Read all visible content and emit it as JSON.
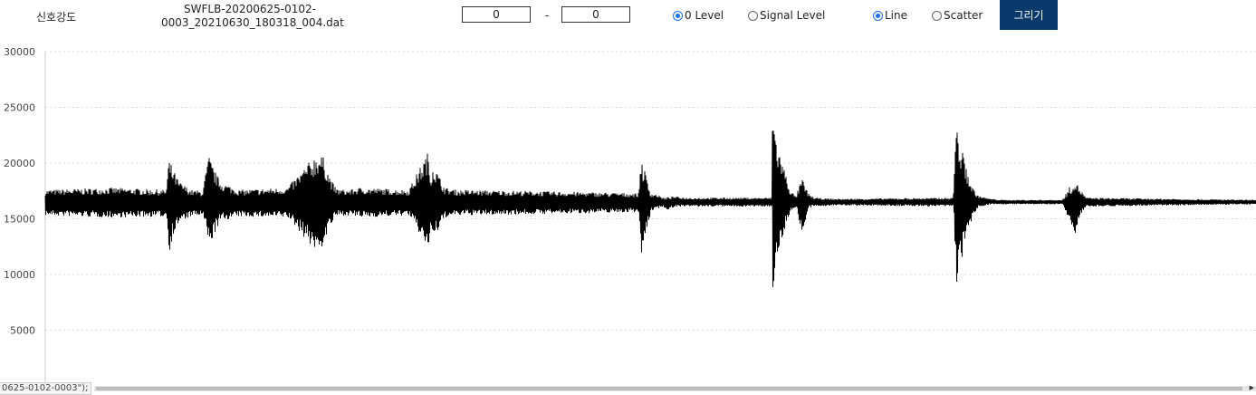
{
  "toolbar": {
    "signal_strength_label": "신호강도",
    "filename_line1": "SWFLB-20200625-0102-",
    "filename_line2": "0003_20210630_180318_004.dat",
    "range_start": "0",
    "range_separator": "-",
    "range_end": "0",
    "radio_zero_level": "0 Level",
    "radio_signal_level": "Signal Level",
    "radio_line": "Line",
    "radio_scatter": "Scatter",
    "level_selected": "0 Level",
    "mode_selected": "Line",
    "draw_button": "그리기"
  },
  "scroll_tooltip": "0625-0102-0003\");",
  "chart_data": {
    "type": "line",
    "title": "",
    "xlabel": "",
    "ylabel": "",
    "ylim": [
      0,
      30000
    ],
    "yticks": [
      5000,
      10000,
      15000,
      20000,
      25000,
      30000
    ],
    "grid": true,
    "line_color": "#000000",
    "baseline": 16500,
    "series": [
      {
        "x_fraction": [
          0.0,
          0.055,
          0.1,
          0.102,
          0.105,
          0.11,
          0.12,
          0.13,
          0.135,
          0.14,
          0.145,
          0.16,
          0.2,
          0.225,
          0.23,
          0.235,
          0.24,
          0.25,
          0.26,
          0.3,
          0.316,
          0.318,
          0.32,
          0.33,
          0.34,
          0.4,
          0.49,
          0.492,
          0.5,
          0.505,
          0.51,
          0.513,
          0.516,
          0.52,
          0.53,
          0.6,
          0.6,
          0.605,
          0.61,
          0.615,
          0.62,
          0.625,
          0.63,
          0.635,
          0.65,
          0.66,
          0.75,
          0.752,
          0.758,
          0.765,
          0.77,
          0.78,
          0.79,
          0.84,
          0.85,
          0.855,
          0.86,
          1.0
        ],
        "envelope_high": [
          17600,
          17800,
          17600,
          20400,
          19600,
          18400,
          17600,
          17500,
          20700,
          19300,
          18300,
          17600,
          17800,
          21000,
          20500,
          18800,
          17700,
          17600,
          17800,
          17600,
          21000,
          18800,
          20000,
          17800,
          17600,
          17500,
          17300,
          20700,
          17300,
          17200,
          16900,
          16900,
          17000,
          17000,
          16900,
          16900,
          25300,
          21500,
          19700,
          17600,
          17000,
          18700,
          17300,
          16900,
          16800,
          16800,
          16900,
          23700,
          20800,
          18000,
          17100,
          16800,
          16700,
          16700,
          18600,
          17600,
          16900,
          16700
        ],
        "envelope_low": [
          15300,
          15100,
          15200,
          12000,
          13400,
          14600,
          15200,
          15300,
          12400,
          13800,
          14800,
          15200,
          15100,
          11800,
          12800,
          14300,
          15200,
          15300,
          15100,
          15300,
          12200,
          14300,
          13000,
          15100,
          15300,
          15400,
          15600,
          11500,
          15700,
          15900,
          16100,
          15800,
          15900,
          16100,
          16100,
          16100,
          7800,
          11800,
          13900,
          15600,
          16100,
          13400,
          15900,
          16100,
          16200,
          16200,
          16100,
          9000,
          12000,
          14900,
          16000,
          16300,
          16300,
          16300,
          13600,
          15400,
          16100,
          16300
        ]
      }
    ]
  }
}
